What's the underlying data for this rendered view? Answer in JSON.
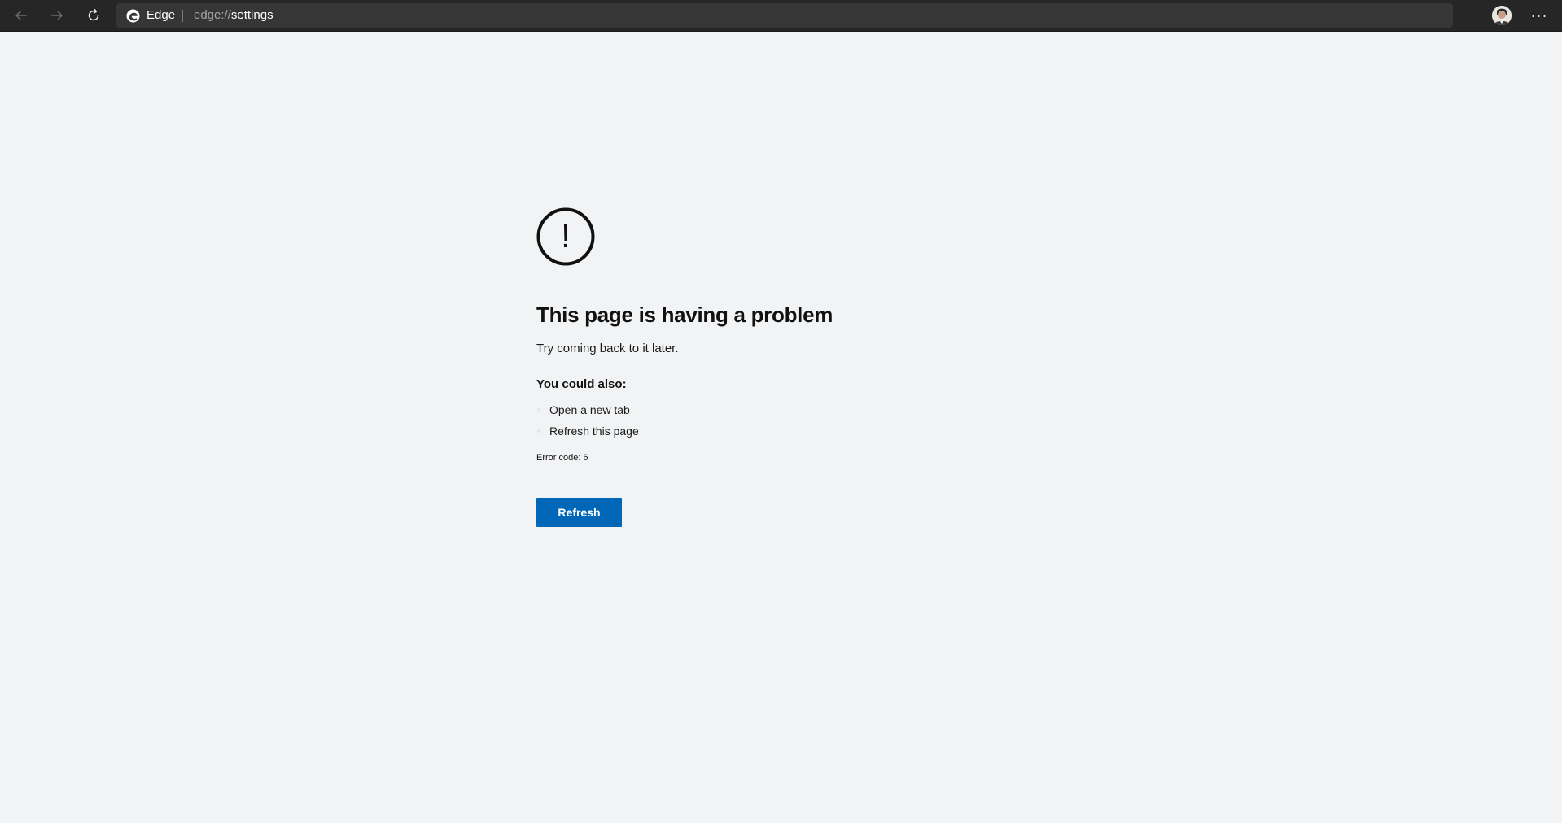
{
  "browser": {
    "site_name": "Edge",
    "url_scheme": "edge://",
    "url_path": "settings",
    "icons": {
      "back": "back-arrow-icon",
      "forward": "forward-arrow-icon",
      "reload": "reload-icon",
      "logo": "edge-logo-icon",
      "favorite": "star-icon",
      "profile": "profile-avatar",
      "more": "more-ellipsis-icon"
    },
    "more_label": "···"
  },
  "error_page": {
    "icon": "warning-circle-icon",
    "icon_glyph": "!",
    "title": "This page is having a problem",
    "subtitle": "Try coming back to it later.",
    "also_heading": "You could also:",
    "suggestions": [
      "Open a new tab",
      "Refresh this page"
    ],
    "error_code": "Error code: 6",
    "refresh_label": "Refresh",
    "accent_color": "#0067b8"
  }
}
